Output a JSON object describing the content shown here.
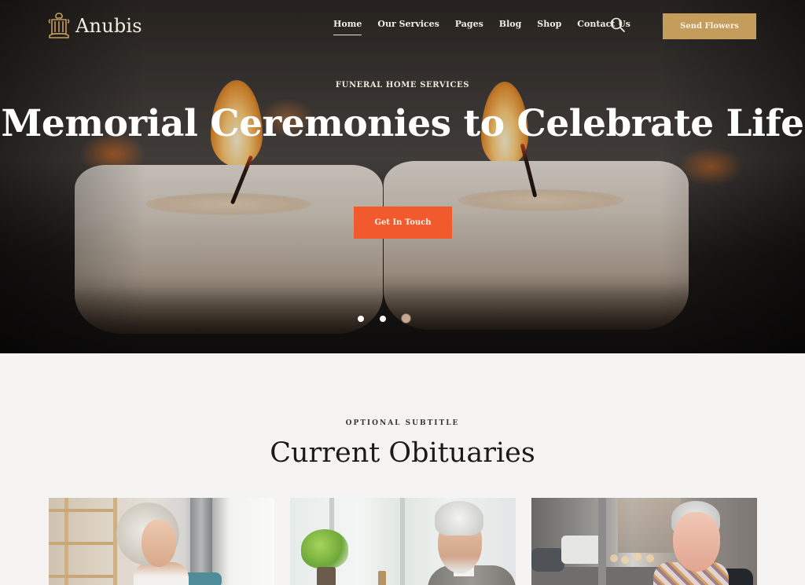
{
  "header": {
    "logo_text": "Anubis",
    "nav": [
      {
        "label": "Home",
        "active": true
      },
      {
        "label": "Our Services",
        "active": false
      },
      {
        "label": "Pages",
        "active": false
      },
      {
        "label": "Blog",
        "active": false
      },
      {
        "label": "Shop",
        "active": false
      },
      {
        "label": "Contact Us",
        "active": false
      }
    ],
    "search_icon": "search-icon",
    "cta_label": "Send Flowers"
  },
  "hero": {
    "kicker": "FUNERAL HOME SERVICES",
    "title": "Memorial Ceremonies to Celebrate Life",
    "button_label": "Get In Touch",
    "slides": 3,
    "active_slide": 3
  },
  "obituaries": {
    "subtitle": "OPTIONAL SUBTITLE",
    "title": "Current Obituaries",
    "cards": [
      {
        "photo": "elderly woman with curly white hair looking out window"
      },
      {
        "photo": "elderly man with white hair and beard smiling"
      },
      {
        "photo": "smiling elderly woman with glasses and scarf on street"
      }
    ]
  },
  "colors": {
    "gold_accent": "#c49c5b",
    "cta_orange": "#f05a2d",
    "page_background": "#f5f4f2",
    "heading_dark": "#1c1a18"
  }
}
